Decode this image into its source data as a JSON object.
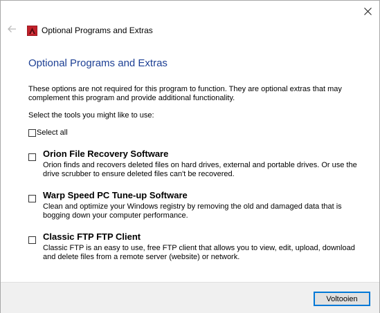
{
  "window": {
    "title": "Optional Programs and Extras",
    "icons": {
      "close": "close-icon",
      "back": "back-arrow-icon",
      "app": "app-icon"
    }
  },
  "page": {
    "title": "Optional Programs and Extras",
    "intro": "These options are not required for this program to function. They are optional extras that may complement this program and provide additional functionality.",
    "select_prompt": "Select the tools you might like to use:",
    "select_all_label": "Select all"
  },
  "options": [
    {
      "title": "Orion File Recovery Software",
      "description": "Orion finds and recovers deleted files on hard drives, external and portable drives. Or use the drive scrubber to ensure deleted files can't be recovered.",
      "checked": false
    },
    {
      "title": "Warp Speed PC Tune-up Software",
      "description": "Clean and optimize your Windows registry by removing the old and damaged data that is bogging down your computer performance.",
      "checked": false
    },
    {
      "title": "Classic FTP FTP Client",
      "description": "Classic FTP is an easy to use, free FTP client that allows you to view, edit, upload, download and delete files from a remote server (website) or network.",
      "checked": false
    }
  ],
  "footer": {
    "finish_label": "Voltooien"
  },
  "colors": {
    "title_blue": "#1c3f94",
    "button_border": "#0078d7",
    "footer_bg": "#f0f0f0",
    "app_icon_red": "#c0202a"
  }
}
